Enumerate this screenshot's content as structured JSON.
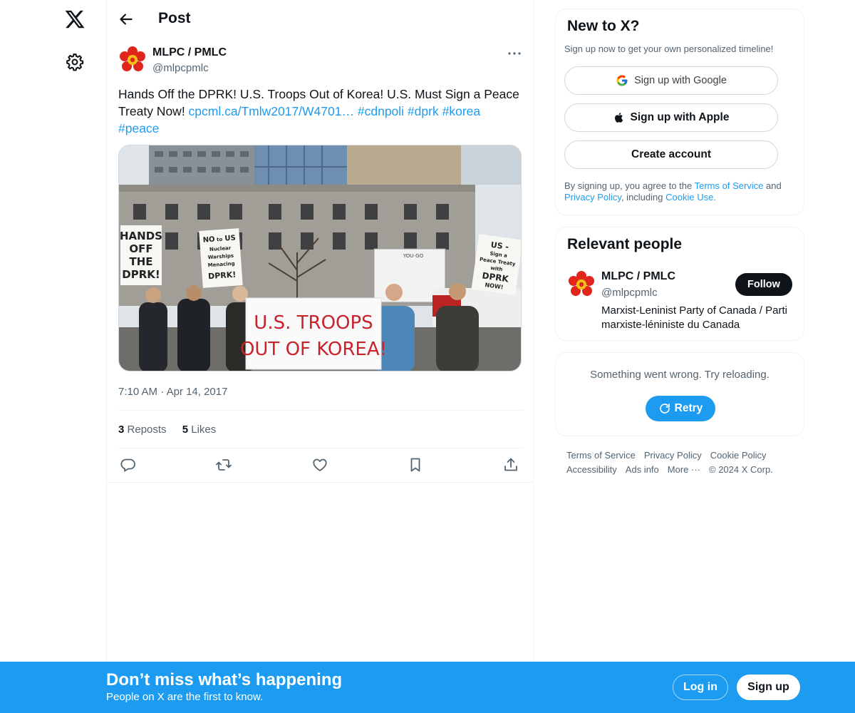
{
  "header": {
    "title": "Post"
  },
  "tweet": {
    "author_name": "MLPC / PMLC",
    "author_handle": "@mlpcpmlc",
    "text_plain": "Hands Off the DPRK! U.S. Troops Out of Korea! U.S. Must Sign a Peace Treaty Now! ",
    "link": "cpcml.ca/Tmlw2017/W4701…",
    "hashtags": [
      "#cdnpoli",
      "#dprk",
      "#korea",
      "#peace"
    ],
    "media": {
      "banner_line1": "U.S. TROOPS",
      "banner_line2": "OUT OF KOREA!",
      "sign1": [
        "HANDS",
        "OFF",
        "THE",
        "DPRK!"
      ],
      "sign2": [
        "NO",
        "to",
        "US",
        "Nuclear",
        "Warships",
        "Menacing",
        "DPRK!"
      ],
      "sign3": [
        "US -",
        "Sign a",
        "Peace Treaty",
        "with",
        "DPRK",
        "NOW!"
      ],
      "truck_label": "YOU-GO"
    },
    "time": "7:10 AM",
    "date": "Apr 14, 2017",
    "dot": "·",
    "reposts_count": "3",
    "reposts_label": "Reposts",
    "likes_count": "5",
    "likes_label": "Likes"
  },
  "signup_card": {
    "title": "New to X?",
    "subtitle": "Sign up now to get your own personalized timeline!",
    "google_label": "Sign up with Google",
    "apple_label": "Sign up with Apple",
    "create_label": "Create account",
    "legal_prefix": "By signing up, you agree to the ",
    "terms": "Terms of Service",
    "and": " and ",
    "privacy": "Privacy Policy",
    "including": ", including ",
    "cookie": "Cookie Use."
  },
  "relevant": {
    "title": "Relevant people",
    "name": "MLPC / PMLC",
    "handle": "@mlpcpmlc",
    "follow_label": "Follow",
    "bio": "Marxist-Leninist Party of Canada / Parti marxiste-léniniste du Canada"
  },
  "error_card": {
    "message": "Something went wrong. Try reloading.",
    "retry_label": "Retry"
  },
  "footer": {
    "links": [
      "Terms of Service",
      "Privacy Policy",
      "Cookie Policy",
      "Accessibility",
      "Ads info",
      "More ···"
    ],
    "copyright": "© 2024 X Corp."
  },
  "banner": {
    "title": "Don’t miss what’s happening",
    "subtitle": "People on X are the first to know.",
    "login_label": "Log in",
    "signup_label": "Sign up"
  },
  "colors": {
    "accent": "#1d9bf0",
    "text": "#0f1419",
    "secondary": "#536471",
    "border": "#eff3f4"
  }
}
